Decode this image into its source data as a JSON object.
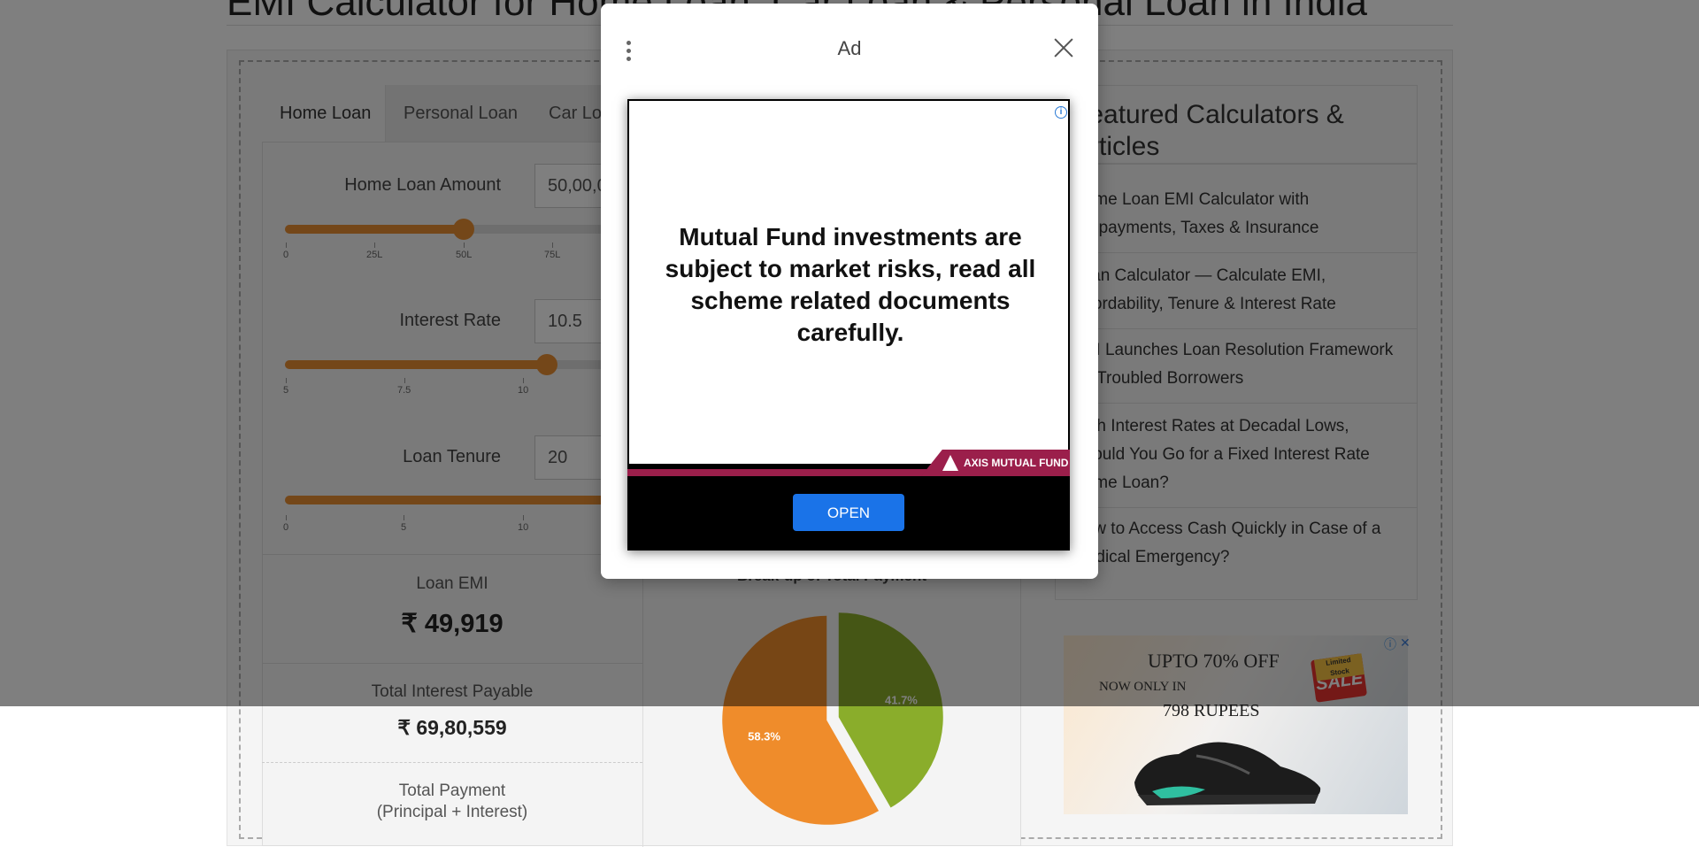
{
  "page": {
    "title": "EMI Calculator for Home Loan, Car Loan & Personal Loan in India"
  },
  "tabs": [
    {
      "label": "Home Loan",
      "active": true
    },
    {
      "label": "Personal Loan",
      "active": false
    },
    {
      "label": "Car Loan",
      "active": false
    }
  ],
  "fields": {
    "amount": {
      "label": "Home Loan Amount",
      "value": "50,00,000",
      "slider_fraction": 0.5,
      "ticks": [
        "0",
        "25L",
        "50L",
        "75L"
      ]
    },
    "rate": {
      "label": "Interest Rate",
      "value": "10.5",
      "slider_fraction": 0.55,
      "ticks": [
        "5",
        "7.5",
        "10"
      ]
    },
    "tenure": {
      "label": "Loan Tenure",
      "value": "20",
      "slider_fraction": 0.62,
      "ticks": [
        "0",
        "5",
        "10"
      ]
    }
  },
  "results": {
    "emi_label": "Loan EMI",
    "emi_value": "₹ 49,919",
    "interest_label": "Total Interest Payable",
    "interest_value": "₹ 69,80,559",
    "total_label_1": "Total Payment",
    "total_label_2": "(Principal + Interest)"
  },
  "chart_data": {
    "type": "pie",
    "title": "Break-up of Total Payment",
    "slices": [
      {
        "label": "41.7%",
        "value": 41.7,
        "color": "#8aad2b"
      },
      {
        "label": "58.3%",
        "value": 58.3,
        "color": "#ef8c2b"
      }
    ]
  },
  "sidebar": {
    "heading": "Featured Calculators & Articles",
    "items": [
      "Home Loan EMI Calculator with Prepayments, Taxes & Insurance",
      "Loan Calculator — Calculate EMI, Affordability, Tenure & Interest Rate",
      "RBI Launches Loan Resolution Framework for Troubled Borrowers",
      "With Interest Rates at Decadal Lows, Should You Go for a Fixed Interest Rate Home Loan?",
      "How to Access Cash Quickly in Case of a Medical Emergency?"
    ]
  },
  "side_ad": {
    "line1": "UPTO 70% OFF",
    "line2": "NOW ONLY IN",
    "line3": "798 RUPEES",
    "tag_small": "Limited Stock",
    "tag": "SALE"
  },
  "modal": {
    "title": "Ad",
    "ad_text": "Mutual Fund investments are subject to market risks, read all scheme related documents carefully.",
    "brand": "AXIS MUTUAL FUND",
    "open_label": "OPEN",
    "info_glyph": "i"
  },
  "colors": {
    "accent": "#e88e33",
    "open_button": "#1a73e8",
    "brand": "#9b1f4b"
  }
}
